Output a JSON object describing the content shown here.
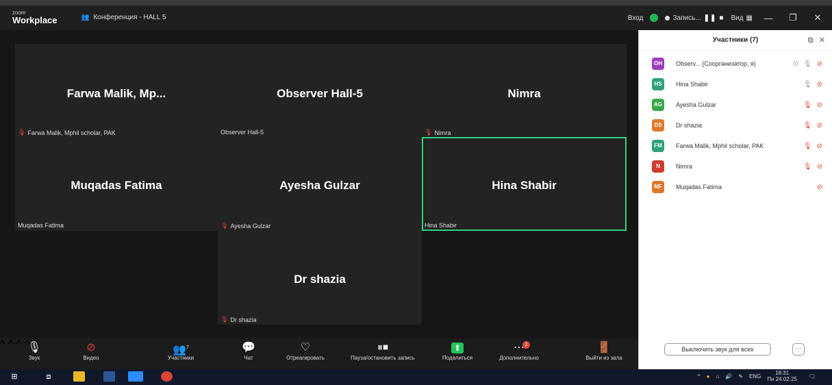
{
  "window": {
    "brand_small": "zoom",
    "brand_name": "Workplace",
    "conference_title": "Конференция - HALL 5",
    "login_label": "Вход",
    "recording_label": "Запись...",
    "view_label": "Вид",
    "minimize": "—",
    "maximize": "❐",
    "close": "✕"
  },
  "tiles": [
    {
      "big_name": "Farwa Malik, Mp...",
      "tag": "Farwa Malik, Mphil scholar, PAK",
      "muted": true
    },
    {
      "big_name": "Observer  Hall-5",
      "tag": "Observer  Hall-5",
      "muted": false
    },
    {
      "big_name": "Nimra",
      "tag": "Nimra",
      "muted": true
    },
    {
      "big_name": "Muqadas Fatima",
      "tag": "Muqadas Fatima",
      "muted": false
    },
    {
      "big_name": "Ayesha Gulzar",
      "tag": "Ayesha Gulzar",
      "muted": true
    },
    {
      "big_name": "Hina Shabir",
      "tag": "Hina Shabir",
      "muted": false,
      "active": true
    },
    {
      "big_name": "Dr shazia",
      "tag": "Dr shazia",
      "muted": true
    }
  ],
  "toolbar": {
    "audio": "Звук",
    "video": "Видео",
    "participants": "Участники",
    "participants_count": "7",
    "chat": "Чат",
    "react": "Отреагировать",
    "pause_record": "Пауза/остановить запись",
    "share": "Поделиться",
    "more": "Дополнительно",
    "more_badge": "2",
    "leave_room": "Выйти из зала"
  },
  "panel": {
    "title": "Участники (7)",
    "participants": [
      {
        "initials": "OH",
        "color": "#9b3fbf",
        "name": "Observ...  (Соорганизатор, я)",
        "mic": "on-host",
        "cam": "off"
      },
      {
        "initials": "HS",
        "color": "#2ea37b",
        "name": "Hina Shabir",
        "mic": "on",
        "cam": "off"
      },
      {
        "initials": "AG",
        "color": "#3aa84a",
        "name": "Ayesha Gulzar",
        "mic": "off",
        "cam": "off"
      },
      {
        "initials": "DS",
        "color": "#e0782a",
        "name": "Dr shazia",
        "mic": "off",
        "cam": "off"
      },
      {
        "initials": "FM",
        "color": "#2ea37b",
        "name": "Farwa Malik, Mphil scholar, PAK",
        "mic": "off",
        "cam": "off"
      },
      {
        "initials": "N",
        "color": "#cf3b2f",
        "name": "Nimra",
        "mic": "off",
        "cam": "off"
      },
      {
        "initials": "MF",
        "color": "#e0782a",
        "name": "Muqadas Fatima",
        "mic": "none",
        "cam": "off"
      }
    ],
    "mute_all": "Выключить звук для всех",
    "more": "···"
  },
  "taskbar": {
    "lang": "ENG",
    "time": "18:31",
    "date": "Пн 24.02.25"
  }
}
